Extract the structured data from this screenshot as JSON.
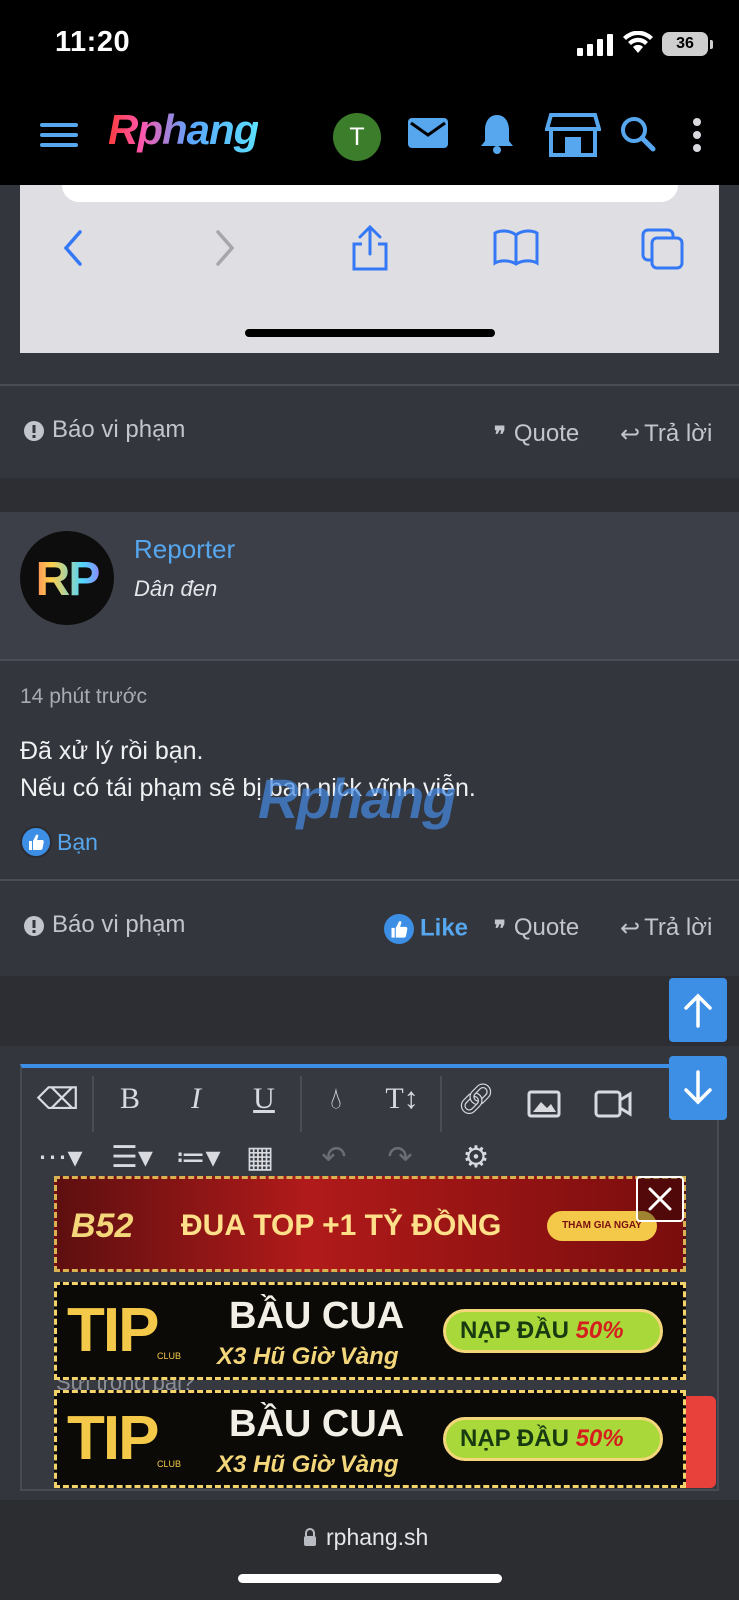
{
  "status_bar": {
    "time": "11:20",
    "battery": "36"
  },
  "header": {
    "logo": "Rphang",
    "avatar_initial": "T"
  },
  "post1_actions": {
    "report": "Báo vi phạm",
    "quote": "Quote",
    "reply": "Trả lời"
  },
  "post2": {
    "avatar_text": "RP",
    "author": "Reporter",
    "user_title": "Dân đen",
    "time": "14 phút trước",
    "body_lines": [
      "Đã xử lý rồi bạn.",
      "Nếu có tái phạm sẽ bị ban nick vĩnh viễn."
    ],
    "watermark": "Rphang",
    "reaction_user": "Bạn",
    "actions": {
      "report": "Báo vi phạm",
      "like": "Like",
      "quote": "Quote",
      "reply": "Trả lời"
    }
  },
  "editor": {
    "placeholder_fragment": "Sửi trong bài?"
  },
  "ads": {
    "top": {
      "brand": "B52",
      "text": "ĐUA TOP +1 TỶ ĐỒNG",
      "cta": "THAM GIA NGAY"
    },
    "tip": {
      "brand": "TIP",
      "brand_sub": "CLUB",
      "title": "BẦU CUA",
      "subtitle": "X3 Hũ Giờ Vàng",
      "cta_prefix": "NẠP ĐẦU",
      "cta_pct": "50%"
    }
  },
  "browser": {
    "url": "rphang.sh"
  },
  "colors": {
    "accent": "#3d8fe6",
    "link": "#56a7ee",
    "background": "#33363d"
  }
}
